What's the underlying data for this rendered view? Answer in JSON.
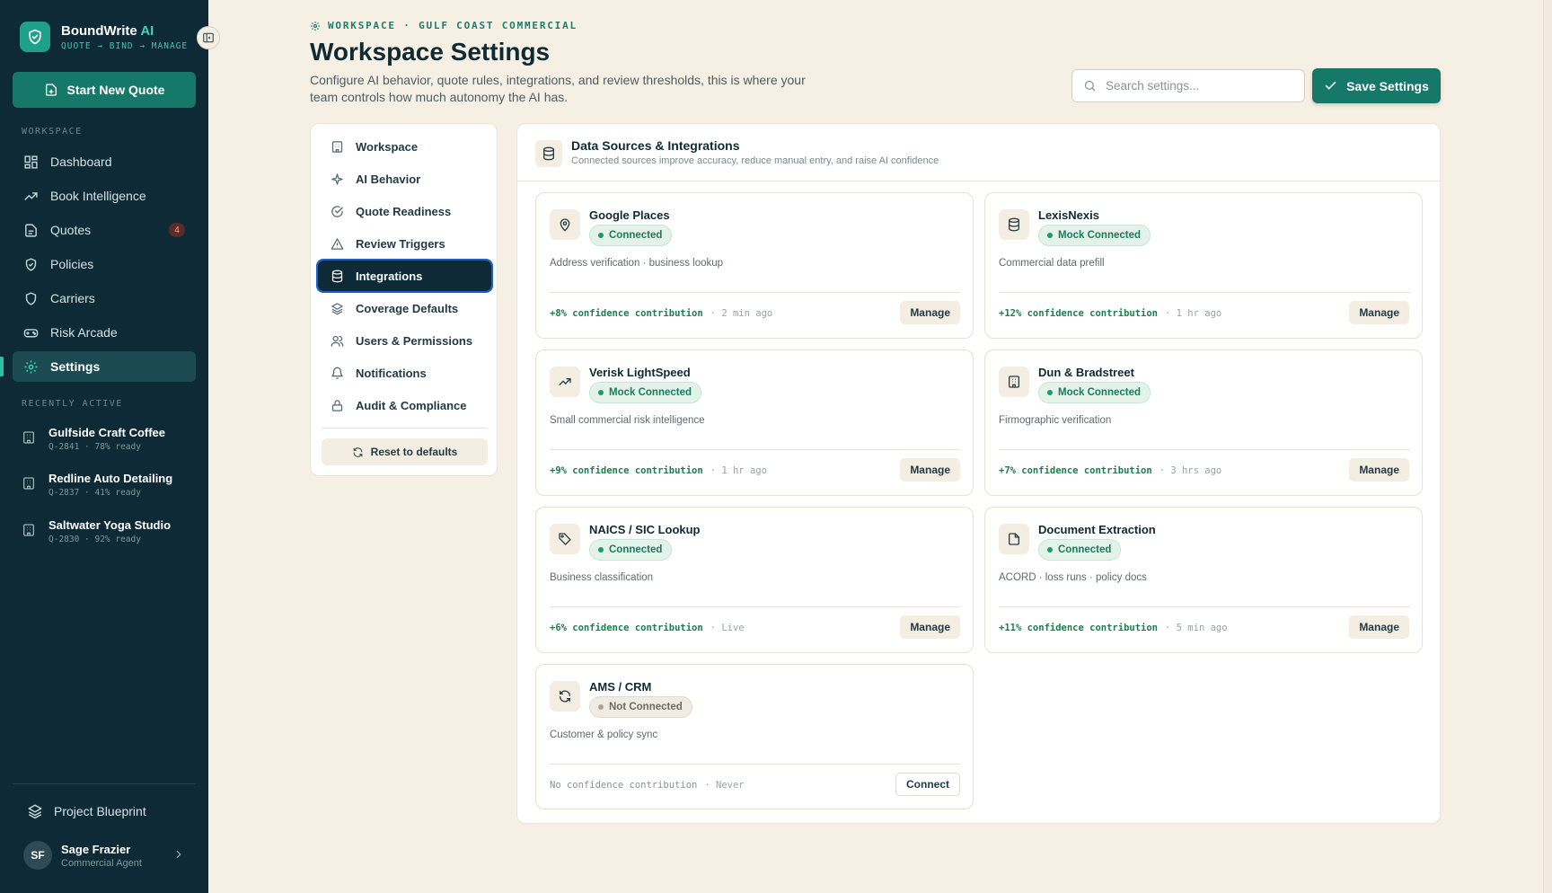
{
  "brand": {
    "name": "BoundWrite",
    "ai": "AI",
    "tagline": "QUOTE → BIND → MANAGE"
  },
  "sidebar": {
    "new_quote_label": "Start New Quote",
    "workspace_label": "WORKSPACE",
    "items": [
      {
        "label": "Dashboard",
        "icon": "dashboard-icon"
      },
      {
        "label": "Book Intelligence",
        "icon": "trending-icon"
      },
      {
        "label": "Quotes",
        "icon": "document-icon",
        "badge": "4"
      },
      {
        "label": "Policies",
        "icon": "shield-icon"
      },
      {
        "label": "Carriers",
        "icon": "shield-outline-icon"
      },
      {
        "label": "Risk Arcade",
        "icon": "gamepad-icon"
      },
      {
        "label": "Settings",
        "icon": "gear-icon",
        "active": true
      }
    ],
    "recent_label": "RECENTLY ACTIVE",
    "recent": [
      {
        "name": "Gulfside Craft Coffee",
        "meta": "Q-2841 · 78% ready"
      },
      {
        "name": "Redline Auto Detailing",
        "meta": "Q-2837 · 41% ready"
      },
      {
        "name": "Saltwater Yoga Studio",
        "meta": "Q-2830 · 92% ready"
      }
    ],
    "blueprint_label": "Project Blueprint",
    "user": {
      "initials": "SF",
      "name": "Sage Frazier",
      "role": "Commercial Agent"
    }
  },
  "header": {
    "eyebrow": "WORKSPACE · GULF COAST COMMERCIAL",
    "title": "Workspace Settings",
    "description": "Configure AI behavior, quote rules, integrations, and review thresholds, this is where your team controls how much autonomy the AI has.",
    "search_placeholder": "Search settings...",
    "save_label": "Save Settings"
  },
  "settings_nav": {
    "items": [
      {
        "label": "Workspace",
        "icon": "building-icon"
      },
      {
        "label": "AI Behavior",
        "icon": "sparkle-icon"
      },
      {
        "label": "Quote Readiness",
        "icon": "check-circle-icon"
      },
      {
        "label": "Review Triggers",
        "icon": "warning-icon"
      },
      {
        "label": "Integrations",
        "icon": "database-icon",
        "active": true
      },
      {
        "label": "Coverage Defaults",
        "icon": "layers-icon"
      },
      {
        "label": "Users & Permissions",
        "icon": "users-icon"
      },
      {
        "label": "Notifications",
        "icon": "bell-icon"
      },
      {
        "label": "Audit & Compliance",
        "icon": "lock-icon"
      }
    ],
    "reset_label": "Reset to defaults"
  },
  "panel": {
    "title": "Data Sources & Integrations",
    "subtitle": "Connected sources improve accuracy, reduce manual entry, and raise AI confidence",
    "integrations": [
      {
        "name": "Google Places",
        "status": "Connected",
        "state": "ok",
        "desc": "Address verification · business lookup",
        "contrib": "+8% confidence contribution",
        "when": "· 2 min ago",
        "action": "Manage",
        "icon": "map-pin-icon"
      },
      {
        "name": "LexisNexis",
        "status": "Mock Connected",
        "state": "ok",
        "desc": "Commercial data prefill",
        "contrib": "+12% confidence contribution",
        "when": "· 1 hr ago",
        "action": "Manage",
        "icon": "database-icon"
      },
      {
        "name": "Verisk LightSpeed",
        "status": "Mock Connected",
        "state": "ok",
        "desc": "Small commercial risk intelligence",
        "contrib": "+9% confidence contribution",
        "when": "· 1 hr ago",
        "action": "Manage",
        "icon": "trending-icon"
      },
      {
        "name": "Dun & Bradstreet",
        "status": "Mock Connected",
        "state": "ok",
        "desc": "Firmographic verification",
        "contrib": "+7% confidence contribution",
        "when": "· 3 hrs ago",
        "action": "Manage",
        "icon": "building-icon"
      },
      {
        "name": "NAICS / SIC Lookup",
        "status": "Connected",
        "state": "ok",
        "desc": "Business classification",
        "contrib": "+6% confidence contribution",
        "when": "· Live",
        "action": "Manage",
        "icon": "tag-icon"
      },
      {
        "name": "Document Extraction",
        "status": "Connected",
        "state": "ok",
        "desc": "ACORD · loss runs · policy docs",
        "contrib": "+11% confidence contribution",
        "when": "· 5 min ago",
        "action": "Manage",
        "icon": "file-icon"
      },
      {
        "name": "AMS / CRM",
        "status": "Not Connected",
        "state": "off",
        "desc": "Customer & policy sync",
        "contrib": "No confidence contribution",
        "when": "· Never",
        "action": "Connect",
        "icon": "refresh-icon"
      }
    ]
  },
  "colors": {
    "sidebar_bg": "#0e2a36",
    "accent": "#167868",
    "page_bg": "#f5efe4",
    "connected": "#1b9a6f"
  }
}
